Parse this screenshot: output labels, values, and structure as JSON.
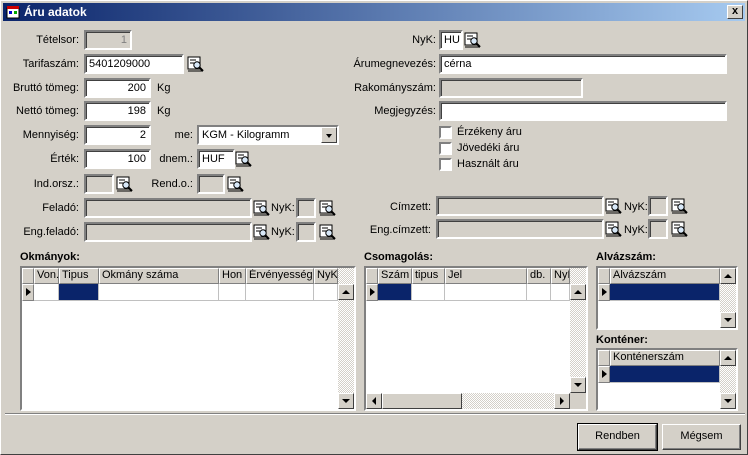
{
  "window": {
    "title": "Áru adatok",
    "close_label": "x"
  },
  "left": {
    "tetelsor": {
      "label": "Tételsor:",
      "value": "1"
    },
    "tarifaszam": {
      "label": "Tarifaszám:",
      "value": "5401209000"
    },
    "brutto": {
      "label": "Bruttó tömeg:",
      "value": "200",
      "unit": "Kg"
    },
    "netto": {
      "label": "Nettó tömeg:",
      "value": "198",
      "unit": "Kg"
    },
    "mennyiseg": {
      "label": "Mennyiség:",
      "value": "2"
    },
    "me": {
      "label": "me:",
      "value": "KGM - Kilogramm"
    },
    "ertek": {
      "label": "Érték:",
      "value": "100"
    },
    "dnem": {
      "label": "dnem.:",
      "value": "HUF"
    },
    "indorsz": {
      "label": "Ind.orsz.:",
      "value": ""
    },
    "rendo": {
      "label": "Rend.o.:",
      "value": ""
    },
    "felado": {
      "label": "Feladó:",
      "value": "",
      "nyk_label": "NyK:"
    },
    "engfelado": {
      "label": "Eng.feladó:",
      "value": "",
      "nyk_label": "NyK:"
    }
  },
  "right": {
    "nyk": {
      "label": "NyK:",
      "value": "HU"
    },
    "arumegnevezes": {
      "label": "Árumegnevezés:",
      "value": "cérna"
    },
    "rakomanyszam": {
      "label": "Rakományszám:",
      "value": ""
    },
    "megjegyzes": {
      "label": "Megjegyzés:",
      "value": ""
    },
    "erzekeny": {
      "label": "Érzékeny áru"
    },
    "jovedeki": {
      "label": "Jövedéki áru"
    },
    "hasznalt": {
      "label": "Használt áru"
    },
    "cimzett": {
      "label": "Címzett:",
      "value": "",
      "nyk_label": "NyK:"
    },
    "engcimzett": {
      "label": "Eng.címzett:",
      "value": "",
      "nyk_label": "NyK:"
    }
  },
  "okmanyok": {
    "title": "Okmányok:",
    "columns": [
      "Von.",
      "Tipus",
      "Okmány száma",
      "Hon",
      "Érvényesség",
      "NyK"
    ]
  },
  "csomagolas": {
    "title": "Csomagolás:",
    "columns": [
      "Szám",
      "tipus",
      "Jel",
      "db.",
      "NyK"
    ]
  },
  "alvazszam": {
    "title": "Alvázszám:",
    "columns": [
      "Alvázszám"
    ]
  },
  "kontener": {
    "title": "Konténer:",
    "columns": [
      "Konténerszám"
    ]
  },
  "buttons": {
    "ok": "Rendben",
    "cancel": "Mégsem"
  },
  "colors": {
    "titlebar": "#0a246a",
    "face": "#d4d0c8",
    "selection": "#0a246a"
  }
}
